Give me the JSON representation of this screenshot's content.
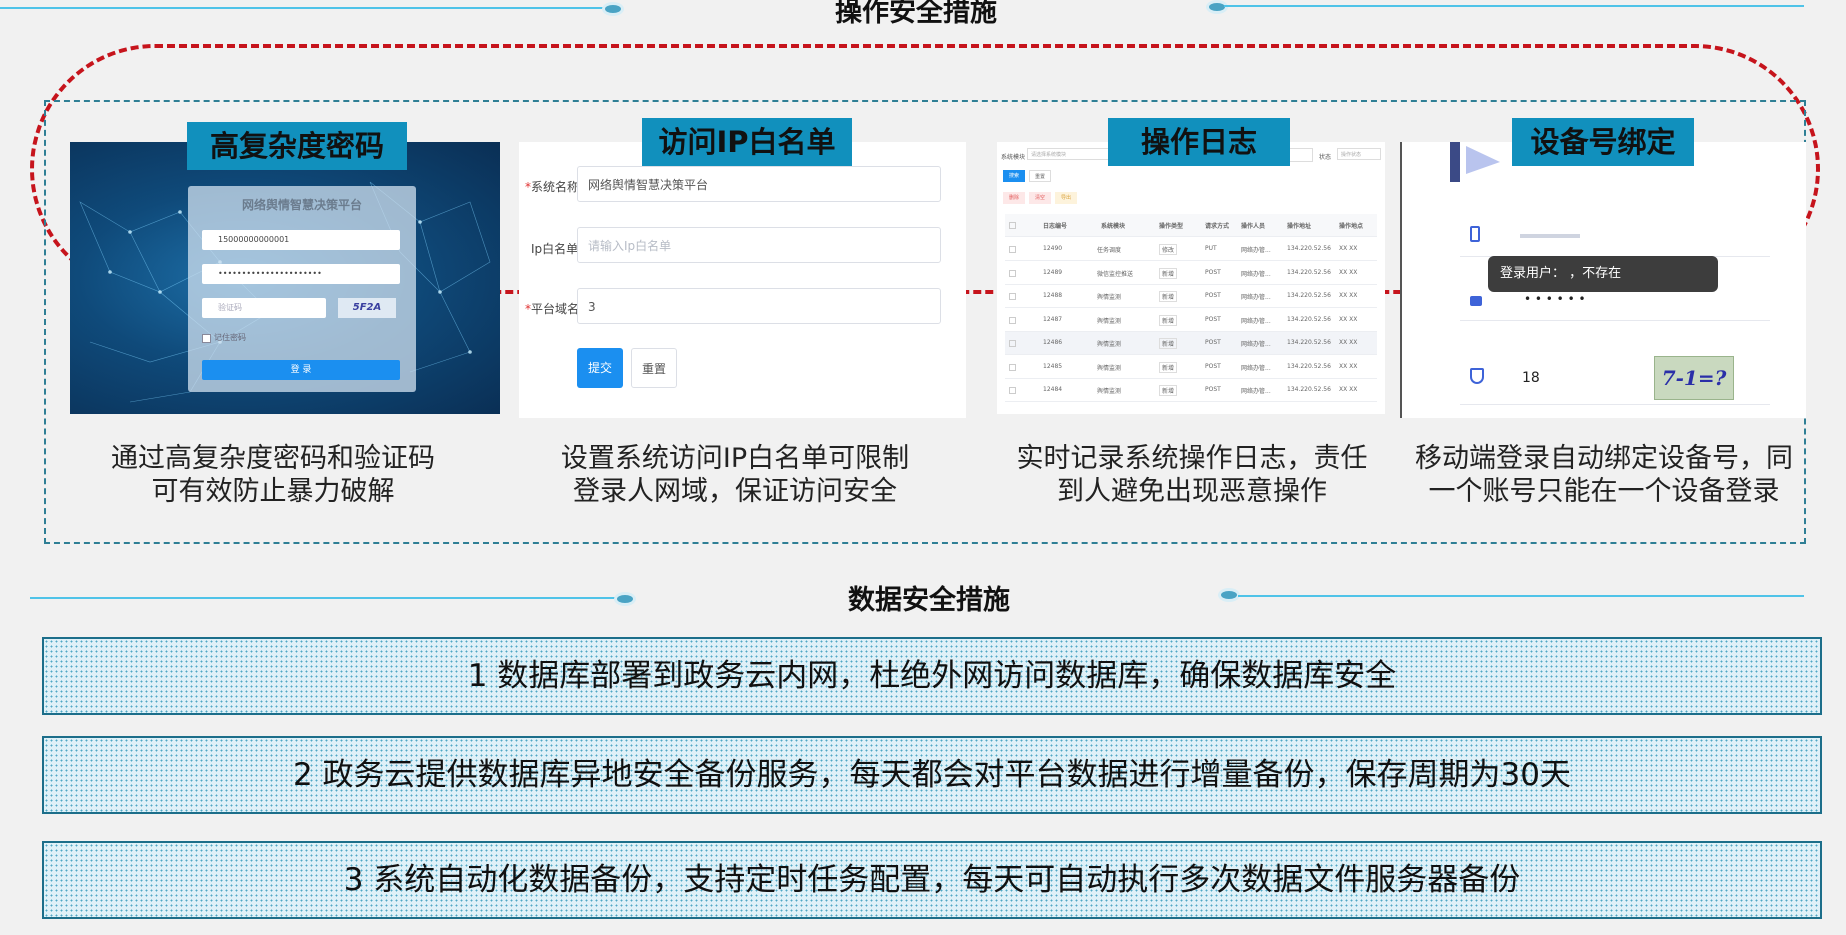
{
  "operation_section": {
    "title": "操作安全措施",
    "cards": [
      {
        "label": "高复杂度密码",
        "caption_lines": [
          "通过高复杂度密码和验证码",
          "可有效防止暴力破解"
        ]
      },
      {
        "label": "访问IP白名单",
        "caption_lines": [
          "设置系统访问IP白名单可限制",
          "登录人网域，保证访问安全"
        ]
      },
      {
        "label": "操作日志",
        "caption_lines": [
          "实时记录系统操作日志，责任",
          "到人避免出现恶意操作"
        ]
      },
      {
        "label": "设备号绑定",
        "caption_lines": [
          "移动端登录自动绑定设备号，同",
          "一个账号只能在一个设备登录"
        ]
      }
    ]
  },
  "login_mock": {
    "title": "网络舆情智慧决策平台",
    "username": "15000000000001",
    "password": "••••••••••••••••••••••",
    "captcha_placeholder": "验证码",
    "captcha_code": "5F2A",
    "remember": "记住密码",
    "login_button": "登 录"
  },
  "whitelist_form": {
    "fields": [
      {
        "label": "系统名称",
        "required": "*",
        "value": "网络舆情智慧决策平台"
      },
      {
        "label": "Ip白名单",
        "required": "",
        "placeholder": "请输入Ip白名单"
      },
      {
        "label": "平台域名",
        "required": "*",
        "value": "3"
      }
    ],
    "submit": "提交",
    "reset": "重置"
  },
  "log_table": {
    "filter_label": "系统模块",
    "filter_placeholder": "请选择系统模块",
    "status_label": "状态",
    "status_placeholder": "操作状态",
    "search_button": "搜索",
    "reset_button": "重置",
    "delete_button": "删除",
    "clear_button": "清空",
    "export_button": "导出",
    "headers": [
      "日志编号",
      "系统模块",
      "操作类型",
      "请求方式",
      "操作人员",
      "操作地址",
      "操作地点"
    ],
    "rows": [
      [
        "12490",
        "任务调度",
        "修改",
        "PUT",
        "网络办管...",
        "134.220.52.56",
        "XX XX"
      ],
      [
        "12489",
        "微信监控推送",
        "新增",
        "POST",
        "网络办管...",
        "134.220.52.56",
        "XX XX"
      ],
      [
        "12488",
        "舆情监测",
        "新增",
        "POST",
        "网络办管...",
        "134.220.52.56",
        "XX XX"
      ],
      [
        "12487",
        "舆情监测",
        "新增",
        "POST",
        "网络办管...",
        "134.220.52.56",
        "XX XX"
      ],
      [
        "12486",
        "舆情监测",
        "新增",
        "POST",
        "网络办管...",
        "134.220.52.56",
        "XX XX"
      ],
      [
        "12485",
        "舆情监测",
        "新增",
        "POST",
        "网络办管...",
        "134.220.52.56",
        "XX XX"
      ],
      [
        "12484",
        "舆情监测",
        "新增",
        "POST",
        "网络办管...",
        "134.220.52.56",
        "XX XX"
      ]
    ]
  },
  "device_mock": {
    "toast": "登录用户：           ，不存在",
    "password_mask": "• • • • • •",
    "code_value": "18",
    "captcha_code": "7-1=?"
  },
  "data_section": {
    "title": "数据安全措施",
    "items": [
      "1 数据库部署到政务云内网，杜绝外网访问数据库，确保数据库安全",
      "2 政务云提供数据库异地安全备份服务，每天都会对平台数据进行增量备份，保存周期为30天",
      "3 系统自动化数据备份，支持定时任务配置，每天可自动执行多次数据文件服务器备份"
    ]
  },
  "colors": {
    "accent": "#1190bd",
    "dash_red": "#c6141c",
    "line_blue": "#4fc3e8",
    "box_border": "#1c6e8a"
  }
}
